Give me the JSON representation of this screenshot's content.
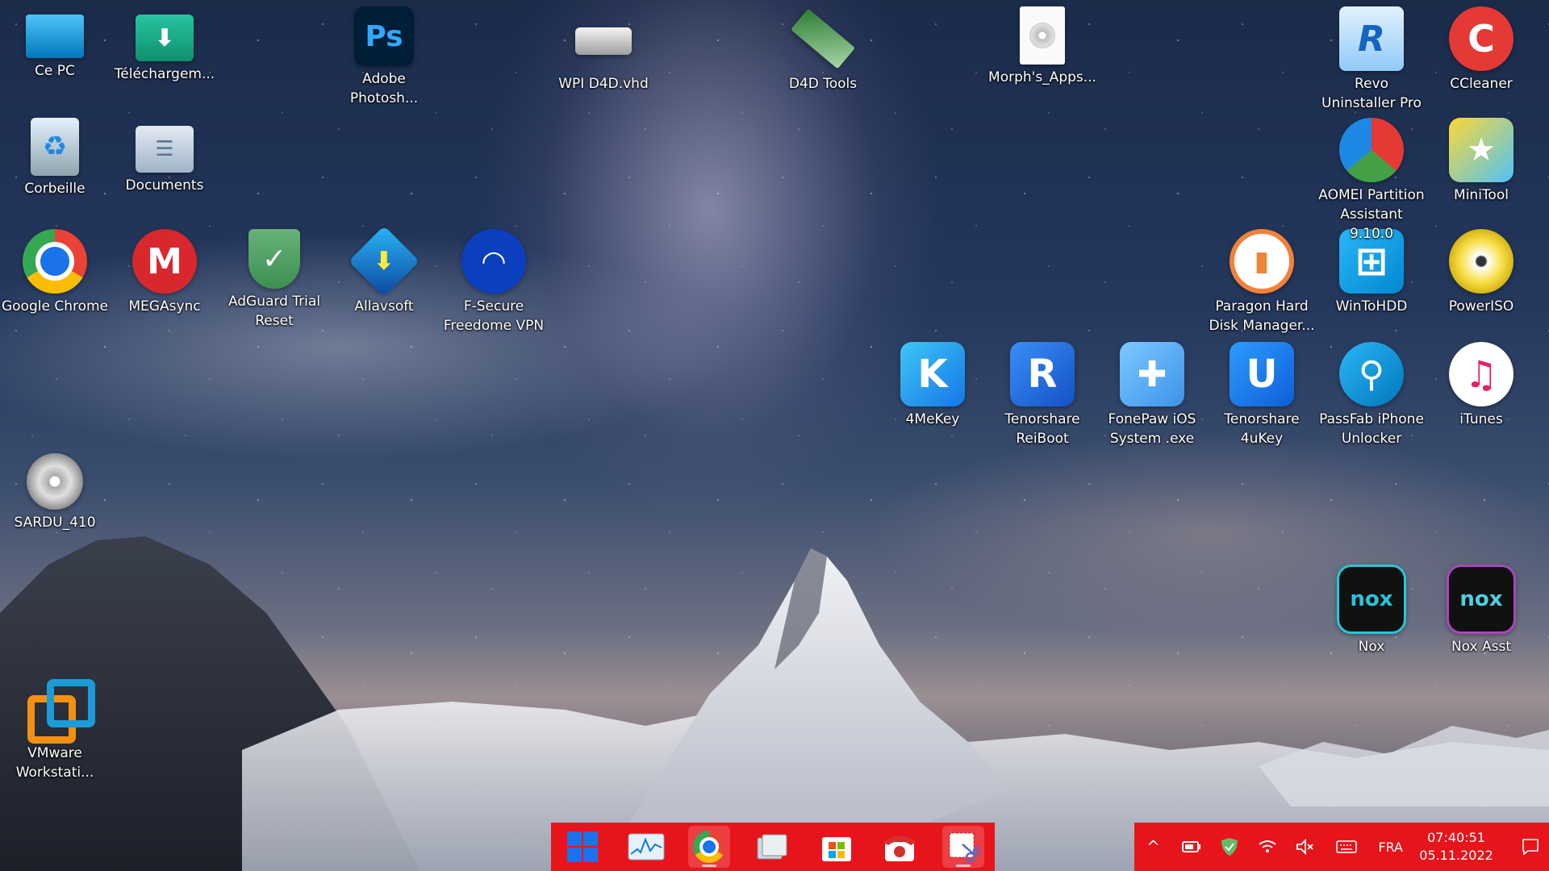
{
  "desktop": {
    "icons": [
      {
        "label": "Ce PC",
        "icon": "monitor-icon"
      },
      {
        "label": "Téléchargem...",
        "icon": "download-folder-icon"
      },
      {
        "label": "Adobe Photosh...",
        "icon": "photoshop-icon",
        "glyph": "Ps"
      },
      {
        "label": "WPI D4D.vhd",
        "icon": "virtual-disk-icon"
      },
      {
        "label": "D4D Tools",
        "icon": "ram-module-icon"
      },
      {
        "label": "Morph's_Apps...",
        "icon": "iso-file-icon"
      },
      {
        "label": "Revo Uninstaller Pro",
        "icon": "revo-uninstaller-icon",
        "glyph": "R"
      },
      {
        "label": "CCleaner",
        "icon": "ccleaner-icon",
        "glyph": "C"
      },
      {
        "label": "Corbeille",
        "icon": "recycle-bin-icon"
      },
      {
        "label": "Documents",
        "icon": "documents-folder-icon"
      },
      {
        "label": "AOMEI Partition Assistant 9.10.0",
        "icon": "aomei-partition-icon"
      },
      {
        "label": "MiniTool",
        "icon": "minitool-icon"
      },
      {
        "label": "Google Chrome",
        "icon": "chrome-icon"
      },
      {
        "label": "MEGAsync",
        "icon": "mega-icon",
        "glyph": "M"
      },
      {
        "label": "AdGuard Trial Reset",
        "icon": "adguard-shield-icon",
        "glyph": "✓"
      },
      {
        "label": "Allavsoft",
        "icon": "allavsoft-icon",
        "glyph": "⬇"
      },
      {
        "label": "F-Secure Freedome VPN",
        "icon": "freedome-vpn-icon"
      },
      {
        "label": "Paragon Hard Disk Manager...",
        "icon": "paragon-icon"
      },
      {
        "label": "WinToHDD",
        "icon": "wintohdd-icon",
        "glyph": "⊞"
      },
      {
        "label": "PowerISO",
        "icon": "poweriso-icon",
        "glyph": "◉"
      },
      {
        "label": "4MeKey",
        "icon": "4mekey-icon",
        "glyph": "K"
      },
      {
        "label": "Tenorshare ReiBoot",
        "icon": "reiboot-icon",
        "glyph": "R"
      },
      {
        "label": "FonePaw iOS System .exe",
        "icon": "fonepaw-icon",
        "glyph": "✚"
      },
      {
        "label": "Tenorshare 4uKey",
        "icon": "4ukey-icon",
        "glyph": "U"
      },
      {
        "label": "PassFab iPhone Unlocker",
        "icon": "passfab-icon",
        "glyph": "⚲"
      },
      {
        "label": "iTunes",
        "icon": "itunes-icon",
        "glyph": "♫"
      },
      {
        "label": "SARDU_410",
        "icon": "sardu-disc-icon"
      },
      {
        "label": "Nox",
        "icon": "nox-icon",
        "glyph": "nox"
      },
      {
        "label": "Nox Asst",
        "icon": "nox-asst-icon",
        "glyph": "nox"
      },
      {
        "label": "VMware Workstati...",
        "icon": "vmware-icon"
      }
    ]
  },
  "taskbar": {
    "apps": [
      {
        "name": "start-button",
        "icon": "windows-logo-icon"
      },
      {
        "name": "task-monitor",
        "icon": "activity-monitor-icon"
      },
      {
        "name": "chrome-taskbar",
        "icon": "chrome-icon"
      },
      {
        "name": "file-explorer",
        "icon": "folders-icon"
      },
      {
        "name": "microsoft-store",
        "icon": "store-icon"
      },
      {
        "name": "phone-app",
        "icon": "telephone-icon"
      },
      {
        "name": "snipping-tool",
        "icon": "scissors-icon"
      }
    ],
    "tray": {
      "language": "FRA",
      "time": "07:40:51",
      "date": "05.11.2022"
    },
    "colors": {
      "bar": "#e8141b"
    }
  }
}
